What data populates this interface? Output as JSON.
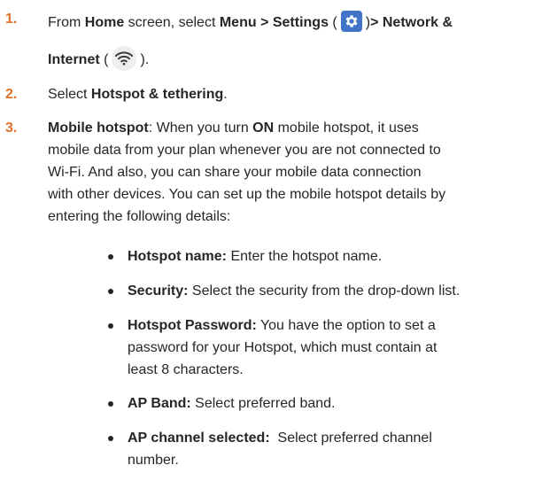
{
  "steps": [
    {
      "number": "1.",
      "line1_pre": "From ",
      "line1_home": "Home",
      "line1_mid": " screen, select ",
      "line1_menu": "Menu > Settings",
      "line1_open1": " (",
      "line1_close1": ")",
      "line1_net": "> Network &",
      "line2_internet": "Internet",
      "line2_open": " (",
      "line2_close": ")."
    },
    {
      "number": "2.",
      "pre": "Select ",
      "bold": "Hotspot & tethering",
      "post": "."
    },
    {
      "number": "3.",
      "bold": "Mobile hotspot",
      "line1_a": ": When you turn ",
      "line1_on": "ON",
      "line1_b": " mobile hotspot, it uses",
      "line2": "mobile data from your plan whenever you are not connected to",
      "line3": "Wi-Fi. And also, you can share your mobile data connection",
      "line4": "with other devices. You can set up the mobile hotspot details by",
      "line5": "entering the following details:"
    }
  ],
  "bullets": [
    {
      "label": "Hotspot name:",
      "lines": [
        " Enter the hotspot name."
      ]
    },
    {
      "label": "Security:",
      "lines": [
        " Select the security from the drop-down list."
      ]
    },
    {
      "label": "Hotspot Password:",
      "lines": [
        " You have the option to set a",
        "password for your Hotspot, which must contain at",
        "least 8 characters."
      ]
    },
    {
      "label": "AP Band:",
      "lines": [
        " Select preferred band."
      ]
    },
    {
      "label": "AP channel selected:",
      "lines": [
        "  Select preferred channel",
        "number."
      ]
    }
  ],
  "icons": {
    "settings": "gear-icon",
    "network": "wifi-icon"
  },
  "colors": {
    "step_number": "#e0702a",
    "settings_icon_bg": "#3f74c9",
    "text": "#262626"
  }
}
